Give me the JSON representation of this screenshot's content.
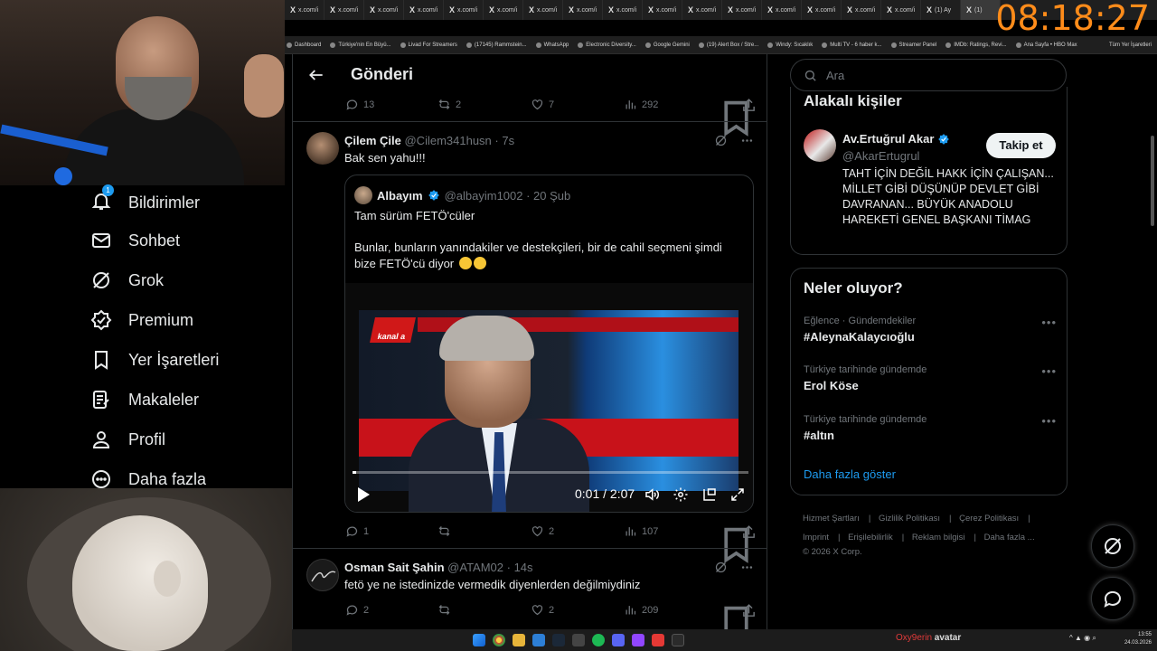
{
  "browser": {
    "tabs": [
      "x.com/i",
      "x.com/i",
      "x.com/i",
      "x.com/i",
      "x.com/i",
      "x.com/i",
      "x.com/i",
      "x.com/i",
      "x.com/i",
      "x.com/i",
      "x.com/i",
      "x.com/i",
      "x.com/i",
      "x.com/i",
      "x.com/i",
      "x.com/i",
      "(1) Ay",
      "(1)"
    ],
    "clock": "08:18:27",
    "bookmarks": [
      "Dashboard",
      "Türkiye'nin En Büyü...",
      "Livad For Streamers",
      "(17145) Rammstein...",
      "WhatsApp",
      "Electronic Diversity...",
      "Google Gemini",
      "(19) Alert Box / Stre...",
      "Windy: Sıcaklık",
      "Multi TV - 6 haber k...",
      "Streamer Panel",
      "IMDb: Ratings, Revi...",
      "Ana Sayfa • HBO Max"
    ],
    "bookmarks_right": "Tüm Yer İşaretleri"
  },
  "nav": {
    "notifications": {
      "label": "Bildirimler",
      "badge": "1"
    },
    "messages": "Sohbet",
    "grok": "Grok",
    "premium": "Premium",
    "bookmarks": "Yer İşaretleri",
    "articles": "Makaleler",
    "profile": "Profil",
    "more": "Daha fazla"
  },
  "header": {
    "title": "Gönderi"
  },
  "top_actions": {
    "replies": "13",
    "reposts": "2",
    "likes": "7",
    "views": "292"
  },
  "tweet1": {
    "name": "Çilem Çile",
    "handle": "@Cilem341husn · 7s",
    "text": "Bak sen yahu!!!",
    "quote": {
      "name": "Albayım",
      "handle": "@albayim1002 · 20 Şub",
      "line1": "Tam sürüm FETÖ'cüler",
      "line2": "Bunlar, bunların yanındakiler ve destekçileri, bir de cahil seçmeni şimdi bize FETÖ'cü diyor"
    },
    "video": {
      "channel": "kanal a",
      "time": "0:01 / 2:07",
      "progress": 0.008
    },
    "actions": {
      "replies": "1",
      "reposts": "",
      "likes": "2",
      "views": "107"
    }
  },
  "tweet2": {
    "name": "Osman Sait Şahin",
    "handle": "@ATAM02 · 14s",
    "text": "fetö ye ne istedinizde vermedik diyenlerden değilmiydiniz",
    "actions": {
      "replies": "2",
      "reposts": "",
      "likes": "2",
      "views": "209"
    }
  },
  "search": {
    "placeholder": "Ara"
  },
  "related": {
    "title": "Alakalı kişiler",
    "name": "Av.Ertuğrul Akar",
    "handle": "@AkarErtugrul",
    "follow": "Takip et",
    "bio": "TAHT İÇİN DEĞİL HAKK İÇİN ÇALIŞAN... MİLLET GİBİ DÜŞÜNÜP DEVLET GİBİ DAVRANAN... BÜYÜK ANADOLU HAREKETİ GENEL BAŞKANI TİMAG"
  },
  "trends": {
    "title": "Neler oluyor?",
    "items": [
      {
        "context": "Eğlence · Gündemdekiler",
        "topic": "#AleynaKalaycıoğlu"
      },
      {
        "context": "Türkiye tarihinde gündemde",
        "topic": "Erol Köse"
      },
      {
        "context": "Türkiye tarihinde gündemde",
        "topic": "#altın"
      }
    ],
    "show_more": "Daha fazla göster"
  },
  "footer": {
    "links": [
      "Hizmet Şartları",
      "Gizlilik Politikası",
      "Çerez Politikası",
      "Imprint",
      "Erişilebilirlik",
      "Reklam bilgisi",
      "Daha fazla ..."
    ],
    "copyright": "© 2026 X Corp."
  },
  "taskbar": {
    "overlay_red": "Oxy9erin",
    "overlay_white": "avatar",
    "time": "13:55",
    "date": "24.03.2026"
  }
}
